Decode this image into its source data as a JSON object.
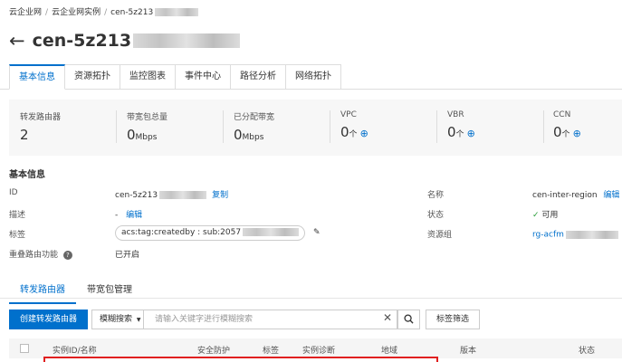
{
  "breadcrumb": {
    "items": [
      "云企业网",
      "云企业网实例",
      "cen-5z213"
    ]
  },
  "header": {
    "back_icon": "←",
    "title": "cen-5z213"
  },
  "tabs": [
    {
      "label": "基本信息",
      "active": true
    },
    {
      "label": "资源拓扑"
    },
    {
      "label": "监控图表"
    },
    {
      "label": "事件中心"
    },
    {
      "label": "路径分析"
    },
    {
      "label": "网络拓扑"
    }
  ],
  "stats": [
    {
      "label": "转发路由器",
      "value": "2",
      "unit": ""
    },
    {
      "label": "带宽包总量",
      "value": "0",
      "unit": "Mbps"
    },
    {
      "label": "已分配带宽",
      "value": "0",
      "unit": "Mbps"
    },
    {
      "label": "VPC",
      "value": "0",
      "unit": "个"
    },
    {
      "label": "VBR",
      "value": "0",
      "unit": "个"
    },
    {
      "label": "CCN",
      "value": "0",
      "unit": "个"
    }
  ],
  "basic": {
    "title": "基本信息",
    "id_label": "ID",
    "id_value": "cen-5z213",
    "copy": "复制",
    "desc_label": "描述",
    "desc_value": "-",
    "edit": "编辑",
    "tag_label": "标签",
    "tag_value": "acs:tag:createdby : sub:2057",
    "overlap_label": "重叠路由功能",
    "overlap_value": "已开启",
    "name_label": "名称",
    "name_value": "cen-inter-region",
    "status_label": "状态",
    "status_value": "可用",
    "rg_label": "资源组",
    "rg_value": "rg-acfm"
  },
  "subtabs": [
    {
      "label": "转发路由器",
      "active": true
    },
    {
      "label": "带宽包管理"
    }
  ],
  "toolbar": {
    "create": "创建转发路由器",
    "select": "模糊搜索",
    "search_placeholder": "请输入关键字进行模糊搜索",
    "filter": "标签筛选"
  },
  "table": {
    "headers": [
      "实例ID/名称",
      "安全防护",
      "标签",
      "实例诊断",
      "地域",
      "版本",
      "状态"
    ]
  },
  "colors": {
    "accent": "#0070cc",
    "highlight": "#e02020"
  }
}
